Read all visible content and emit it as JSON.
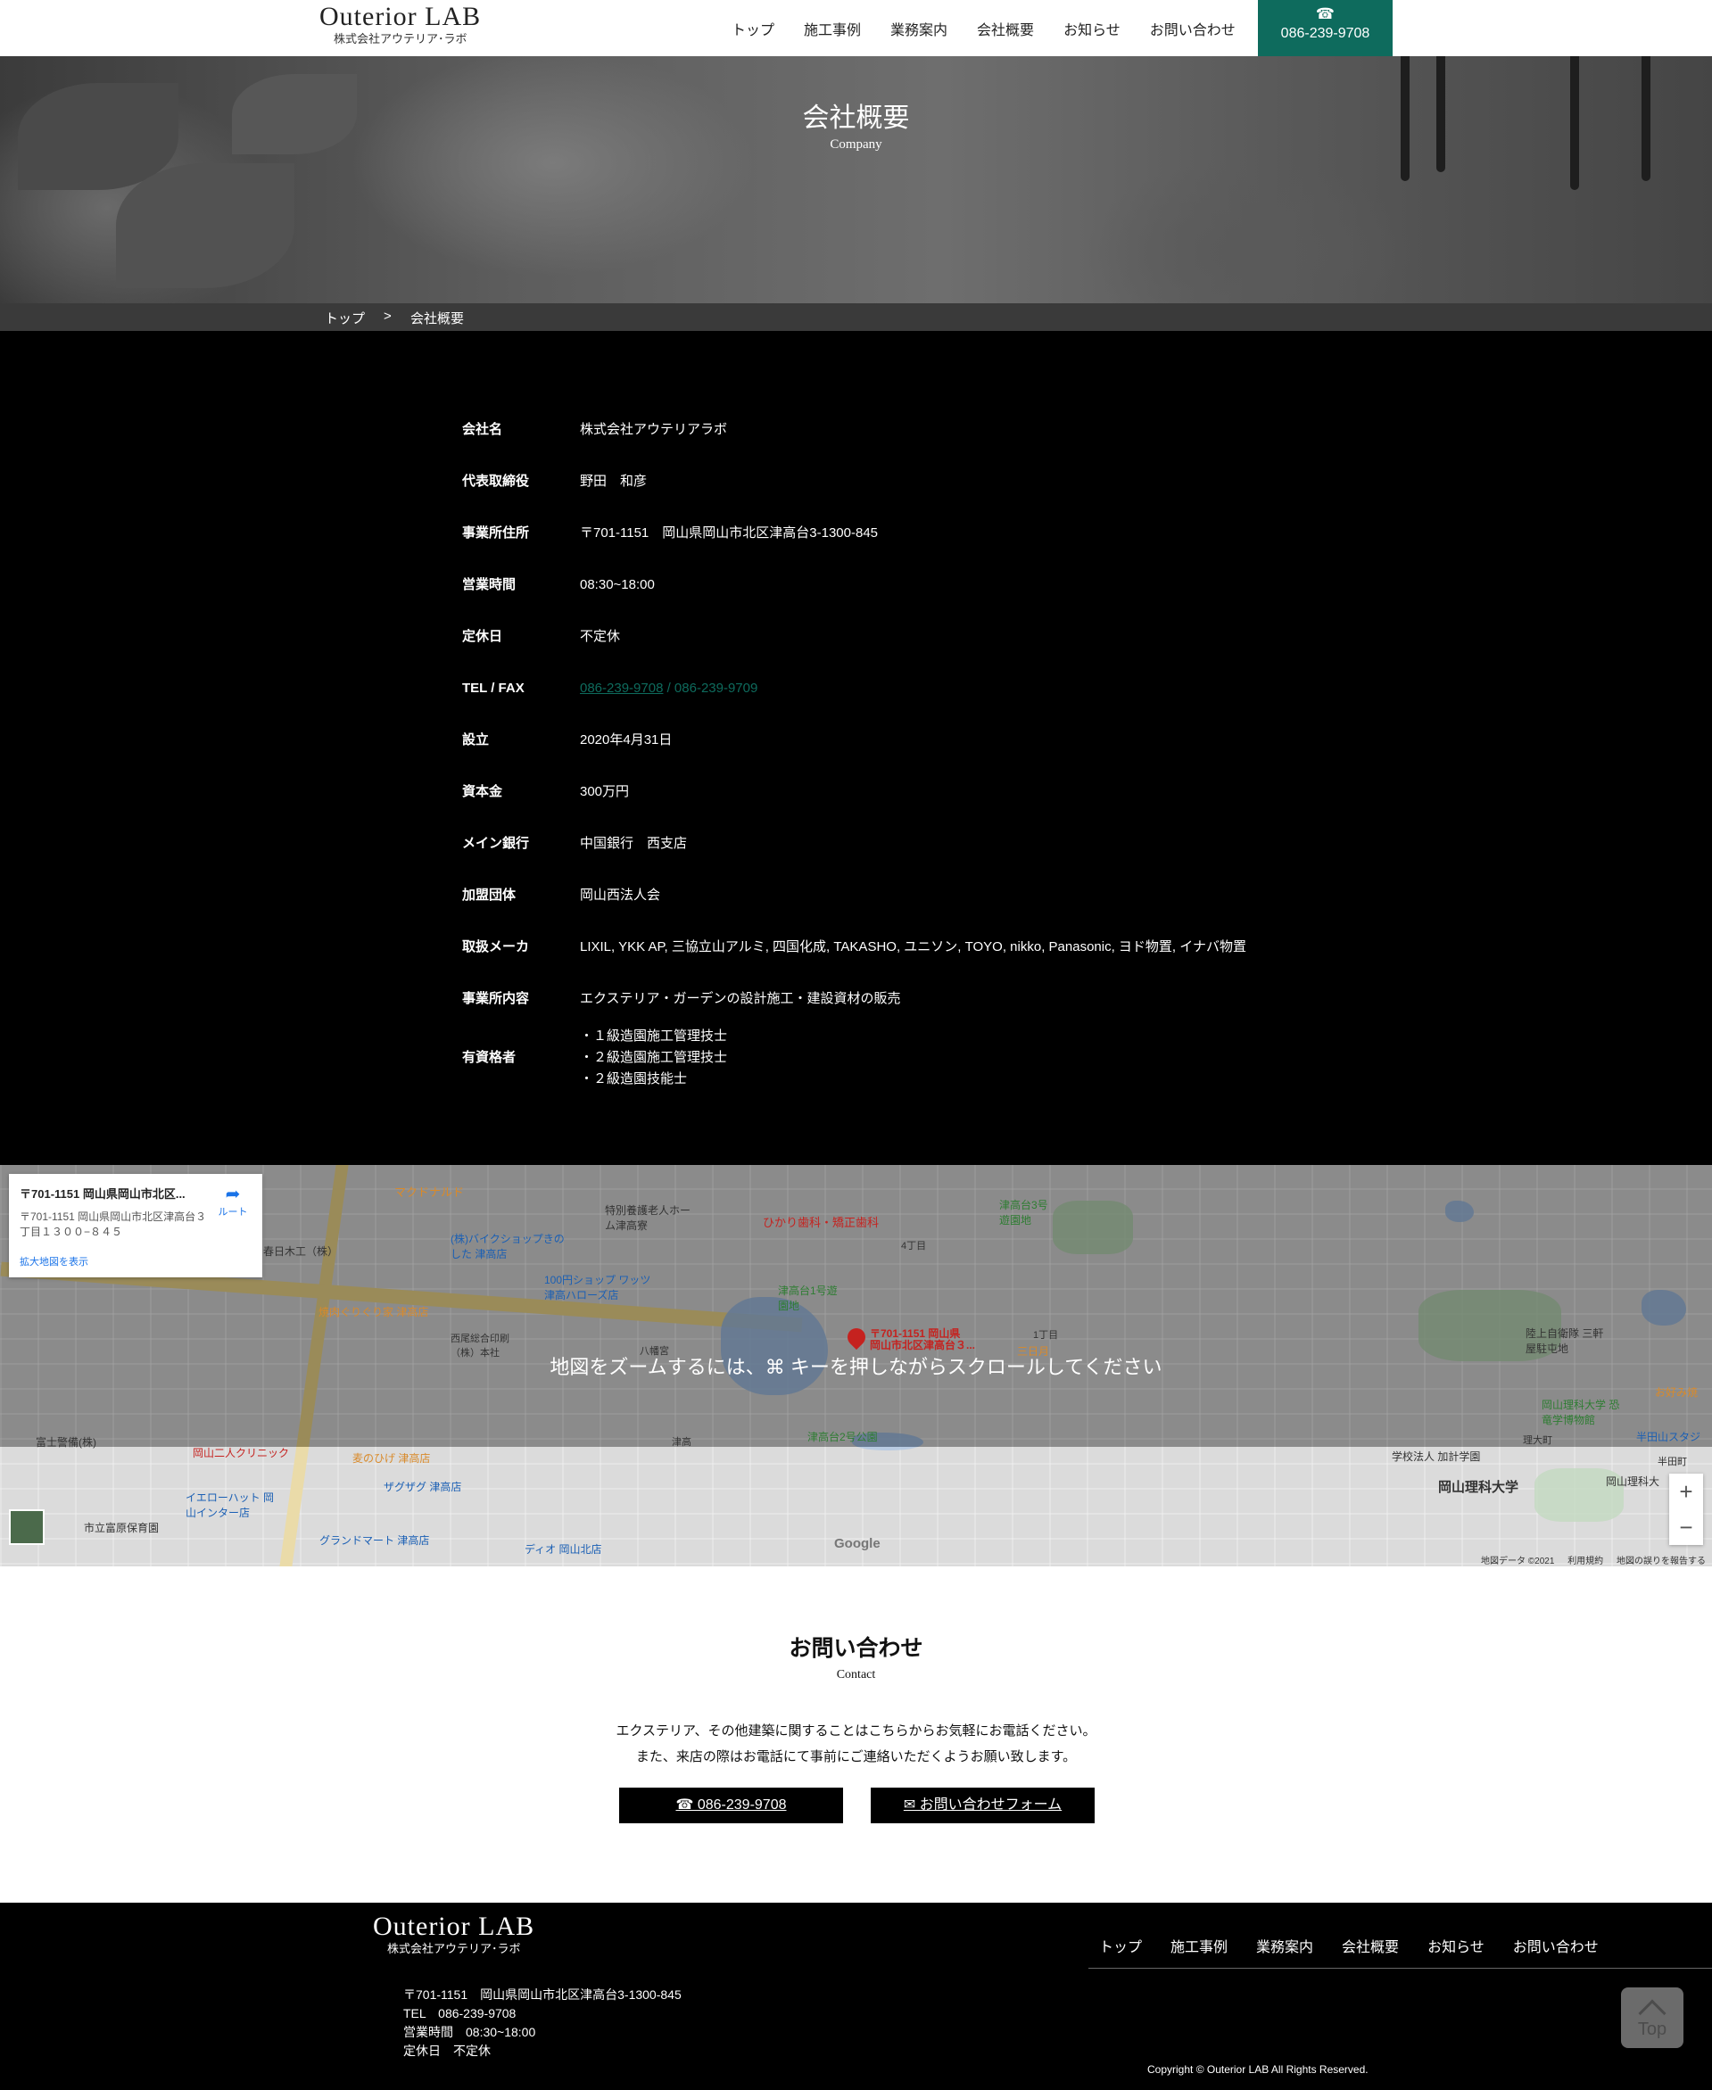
{
  "header": {
    "logo_title": "Outerior LAB",
    "logo_sub": "株式会社アウテリア･ラボ",
    "nav": [
      "トップ",
      "施工事例",
      "業務案内",
      "会社概要",
      "お知らせ",
      "お問い合わせ"
    ],
    "tel": "086-239-9708",
    "tel_icon": "☎"
  },
  "hero": {
    "title": "会社概要",
    "subtitle": "Company"
  },
  "breadcrumb": {
    "home": "トップ",
    "sep": ">",
    "current": "会社概要"
  },
  "company": {
    "rows": [
      {
        "k": "会社名",
        "v": "株式会社アウテリアラボ"
      },
      {
        "k": "代表取締役",
        "v": "野田　和彦"
      },
      {
        "k": "事業所住所",
        "v": "〒701-1151　岡山県岡山市北区津高台3-1300-845"
      },
      {
        "k": "営業時間",
        "v": "08:30~18:00"
      },
      {
        "k": "定休日",
        "v": "不定休"
      },
      {
        "k": "TEL / FAX",
        "tel": "086-239-9708",
        "fax": " / 086-239-9709"
      },
      {
        "k": "設立",
        "v": "2020年4月31日"
      },
      {
        "k": "資本金",
        "v": "300万円"
      },
      {
        "k": "メイン銀行",
        "v": "中国銀行　西支店"
      },
      {
        "k": "加盟団体",
        "v": "岡山西法人会"
      },
      {
        "k": "取扱メーカ",
        "v": "LIXIL, YKK AP, 三協立山アルミ, 四国化成, TAKASHO, ユニソン, TOYO, nikko, Panasonic, ヨド物置, イナバ物置"
      },
      {
        "k": "事業所内容",
        "v": "エクステリア・ガーデンの設計施工・建設資材の販売"
      },
      {
        "k": "有資格者",
        "v1": "・１級造園施工管理技士",
        "v2": "・２級造園施工管理技士",
        "v3": "・２級造園技能士"
      }
    ]
  },
  "map": {
    "card_title": "〒701-1151 岡山県岡山市北区...",
    "card_address": "〒701-1151 岡山県岡山市北区津高台３丁目１３００−８４５",
    "card_link": "拡大地図を表示",
    "route_label": "ルート",
    "overlay_msg": "地図をズームするには、⌘ キーを押しながらスクロールしてください",
    "pin_label_1": "〒701-1151 岡山県",
    "pin_label_2": "岡山市北区津高台３...",
    "zoom_in": "+",
    "zoom_out": "−",
    "google": "Google",
    "attr": [
      "地図データ ©2021",
      "利用規約",
      "地図の誤りを報告する"
    ],
    "places": [
      {
        "name": "マクドナルド"
      },
      {
        "name": "ひかり歯科・矯正歯科"
      },
      {
        "name": "津高台3号遊園地"
      },
      {
        "name": "春日木工（株）"
      },
      {
        "name": "特別養護老人ホーム津高寮"
      },
      {
        "name": "(株)バイクショップきのした 津高店"
      },
      {
        "name": "100円ショップ ワッツ津高ハローズ店"
      },
      {
        "name": "焼肉ぐりぐり家 津高店"
      },
      {
        "name": "津高台1号遊園地"
      },
      {
        "name": "4丁目"
      },
      {
        "name": "西尾総合印刷（株）本社"
      },
      {
        "name": "八幡宮"
      },
      {
        "name": "三日月"
      },
      {
        "name": "陸上自衛隊 三軒屋駐屯地"
      },
      {
        "name": "岡山理科大学 恐竜学博物館"
      },
      {
        "name": "お好み焼"
      },
      {
        "name": "富士警備(株)"
      },
      {
        "name": "岡山二人クリニック"
      },
      {
        "name": "津高台2号公園"
      },
      {
        "name": "学校法人 加計学園"
      },
      {
        "name": "理大町"
      },
      {
        "name": "半田山スタジ"
      },
      {
        "name": "麦のひげ 津高店"
      },
      {
        "name": "イエローハット 岡山インター店"
      },
      {
        "name": "ザグザグ 津高店"
      },
      {
        "name": "岡山理科大学"
      },
      {
        "name": "岡山理科大"
      },
      {
        "name": "市立富原保育園"
      },
      {
        "name": "グランドマート 津高店"
      },
      {
        "name": "ディオ 岡山北店"
      },
      {
        "name": "半田町"
      },
      {
        "name": "津高"
      },
      {
        "name": "1丁目"
      }
    ]
  },
  "contact": {
    "title": "お問い合わせ",
    "subtitle": "Contact",
    "text1": "エクステリア、その他建築に関することはこちらからお気軽にお電話ください。",
    "text2": "また、来店の際はお電話にて事前にご連絡いただくようお願い致します。",
    "tel_btn": "☎ 086-239-9708",
    "form_btn": "✉ お問い合わせフォーム"
  },
  "footer": {
    "logo_title": "Outerior LAB",
    "logo_sub": "株式会社アウテリア･ラボ",
    "nav": [
      "トップ",
      "施工事例",
      "業務案内",
      "会社概要",
      "お知らせ",
      "お問い合わせ"
    ],
    "address": "〒701-1151　岡山県岡山市北区津高台3-1300-845",
    "tel": "TEL　086-239-9708",
    "hours": "営業時間　08:30~18:00",
    "holiday": "定休日　不定休",
    "copyright": "Copyright © Outerior LAB All Rights Reserved.",
    "top_label": "Top"
  },
  "colors": {
    "accent": "#0e6b5d",
    "dark": "#000000",
    "breadcrumb_bg": "#3a3a3a"
  }
}
